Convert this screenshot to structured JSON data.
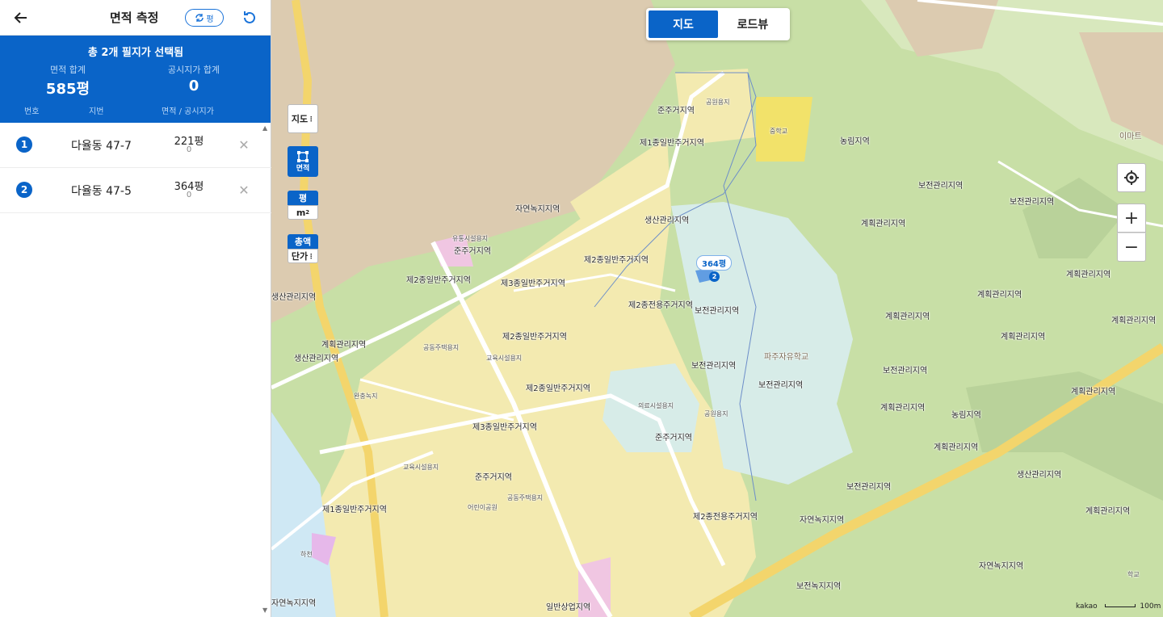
{
  "header": {
    "title": "면적 측정",
    "unit_toggle_label": "평"
  },
  "summary": {
    "title": "총 2개 필지가 선택됨",
    "area_label": "면적 합계",
    "area_value": "585평",
    "price_label": "공시지가 합계",
    "price_value": "0",
    "col_number": "번호",
    "col_lot": "지번",
    "col_area_price": "면적 / 공시지가"
  },
  "parcels": [
    {
      "num": "1",
      "lot": "다율동 47-7",
      "area": "221평",
      "price": "0"
    },
    {
      "num": "2",
      "lot": "다율동 47-5",
      "area": "364평",
      "price": "0"
    }
  ],
  "map": {
    "tabs": [
      {
        "label": "지도",
        "active": true
      },
      {
        "label": "로드뷰",
        "active": false
      }
    ],
    "tools": {
      "map_type": "지도",
      "area": "면적",
      "pyeong": "평",
      "sqm": "m",
      "total_price": "총액",
      "unit_price": "단가"
    },
    "parcel_tag": "364평",
    "parcel_pin": "2",
    "brand": "kakao",
    "scale": "100m",
    "labels": [
      "준주거지역",
      "제1종일반주거지역",
      "공원용지",
      "중학교",
      "농림지역",
      "보전관리지역",
      "자연녹지지역",
      "생산관리지역",
      "계획관리지역",
      "준주거지역",
      "제2종일반주거지역",
      "제2종일반주거지역",
      "제3종일반주거지역",
      "제2종전용주거지역",
      "보전관리지역",
      "제2종일반주거지역",
      "공동주택용지",
      "교육시설용지",
      "제2종일반주거지역",
      "보전관리지역",
      "보전관리지역",
      "제3종일반주거지역",
      "준주거지역",
      "준주거지역",
      "제1종일반주거지역",
      "제2종전용주거지역",
      "자연녹지지역",
      "보전관리지역",
      "일반상업지역",
      "자연녹지지역",
      "보전녹지지역",
      "자연녹지지역",
      "생산관리지역",
      "계획관리지역",
      "계획관리지역",
      "계획관리지역",
      "계획관리지역",
      "계획관리지역",
      "농림지역",
      "보전관리지역",
      "생산관리지역",
      "계획관리지역",
      "생산관리지역",
      "계획관리지역",
      "계획관리지역",
      "계획관리지역",
      "보전관리지역",
      "계획관리지역"
    ],
    "poi": [
      "파주자유학교",
      "유통시설용지",
      "의료시설용지",
      "공원용지",
      "완충녹지",
      "공동주택용지",
      "교육시설용지",
      "어린이공원",
      "학교",
      "이마트",
      "하천"
    ]
  }
}
